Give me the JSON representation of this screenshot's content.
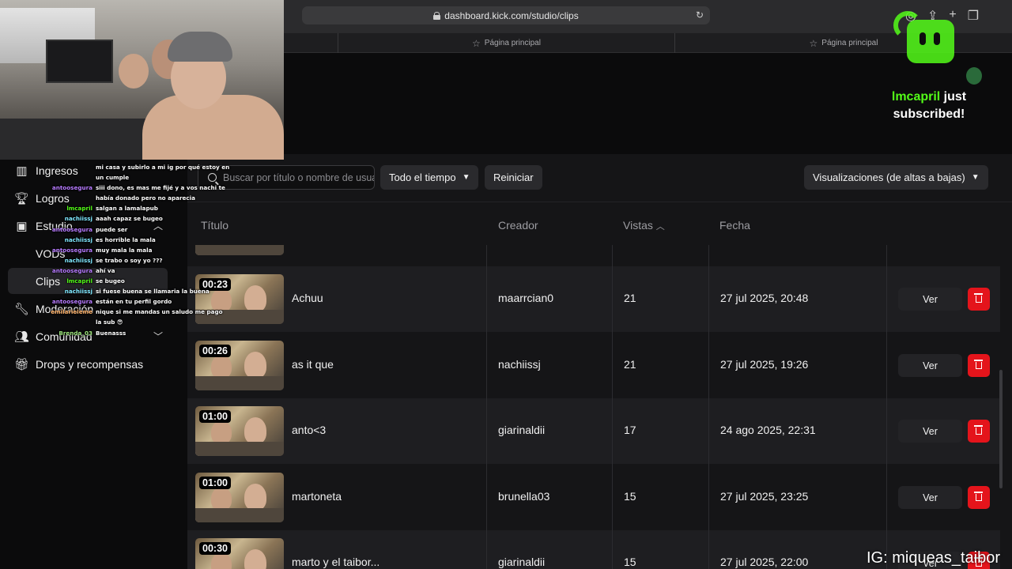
{
  "browser": {
    "url": "dashboard.kick.com/studio/clips",
    "tabs": [
      "Página principal",
      "Página principal"
    ]
  },
  "sidebar": {
    "items": [
      {
        "label": "Ingresos",
        "icon": "bar-chart-icon"
      },
      {
        "label": "Logros",
        "icon": "trophy-icon"
      },
      {
        "label": "Estudio",
        "icon": "video-frame-icon",
        "expanded": true
      },
      {
        "label": "VODs",
        "sub": true
      },
      {
        "label": "Clips",
        "sub": true,
        "active": true
      },
      {
        "label": "Moderación",
        "icon": "wrench-icon"
      },
      {
        "label": "Comunidad",
        "icon": "users-icon",
        "expanded": false
      },
      {
        "label": "Drops y recompensas",
        "icon": "gift-icon"
      }
    ]
  },
  "toolbar": {
    "search_placeholder": "Buscar por título o nombre de usuario",
    "time_filter": "Todo el tiempo",
    "reset_label": "Reiniciar",
    "sort_label": "Visualizaciones (de altas a bajas)"
  },
  "table": {
    "headers": {
      "title": "Título",
      "creator": "Creador",
      "views": "Vistas",
      "date": "Fecha"
    },
    "rows": [
      {
        "duration": "00:23",
        "title": "Achuu",
        "creator": "maarrcian0",
        "views": "21",
        "date": "27 jul 2025, 20:48",
        "action": "Ver"
      },
      {
        "duration": "00:26",
        "title": "as it que",
        "creator": "nachiissj",
        "views": "21",
        "date": "27 jul 2025, 19:26",
        "action": "Ver"
      },
      {
        "duration": "01:00",
        "title": "anto<3",
        "creator": "giarinaldii",
        "views": "17",
        "date": "24 ago 2025, 22:31",
        "action": "Ver"
      },
      {
        "duration": "01:00",
        "title": "martoneta",
        "creator": "brunella03",
        "views": "15",
        "date": "27 jul 2025, 23:25",
        "action": "Ver"
      },
      {
        "duration": "00:30",
        "title": "marto y el taibor...",
        "creator": "giarinaldii",
        "views": "15",
        "date": "27 jul 2025, 22:00",
        "action": "Ver"
      }
    ]
  },
  "chat": {
    "lines": [
      {
        "name": "",
        "text": "mi casa y subirlo a mi ig por qué estoy en"
      },
      {
        "name": "",
        "text": "un cumple"
      },
      {
        "name": "antoosegura",
        "text": "siii dono, es mas me fijé y a vos nachi te",
        "color": "#b77bff"
      },
      {
        "name": "",
        "text": "había donado pero no aparecia"
      },
      {
        "name": "lmcapril",
        "text": "salgan a lamalapub",
        "color": "#53fc18"
      },
      {
        "name": "nachiissj",
        "text": "aaah capaz se bugeo",
        "color": "#7fe8ff"
      },
      {
        "name": "antoosegura",
        "text": "puede ser",
        "color": "#b77bff"
      },
      {
        "name": "nachiissj",
        "text": "es horrible la mala",
        "color": "#7fe8ff"
      },
      {
        "name": "antoosegura",
        "text": "muy mala la mala",
        "color": "#b77bff"
      },
      {
        "name": "nachiissj",
        "text": "se trabo o soy yo ???",
        "color": "#7fe8ff"
      },
      {
        "name": "antoosegura",
        "text": "ahí va",
        "color": "#b77bff"
      },
      {
        "name": "lmcapril",
        "text": "se bugeo",
        "color": "#53fc18"
      },
      {
        "name": "nachiissj",
        "text": "si fuese buena se llamaria la buena",
        "color": "#7fe8ff"
      },
      {
        "name": "antoosegura",
        "text": "están en tu perfil gordo",
        "color": "#b77bff"
      },
      {
        "name": "emilarieleme",
        "text": "nique si me mandas un saludo me pago",
        "color": "#ffb36b"
      },
      {
        "name": "",
        "text": "la sub 😎"
      },
      {
        "name": "Brenda_03",
        "text": "Buenasss",
        "color": "#9be37a"
      }
    ]
  },
  "alert": {
    "user": "lmcapril",
    "text_after_user": " just",
    "line2": "subscribed!",
    "accent": "#53fc18"
  },
  "watermark": "IG: miqueas_taibor",
  "colors": {
    "brand": "#53fc18",
    "delete": "#e4141b"
  }
}
